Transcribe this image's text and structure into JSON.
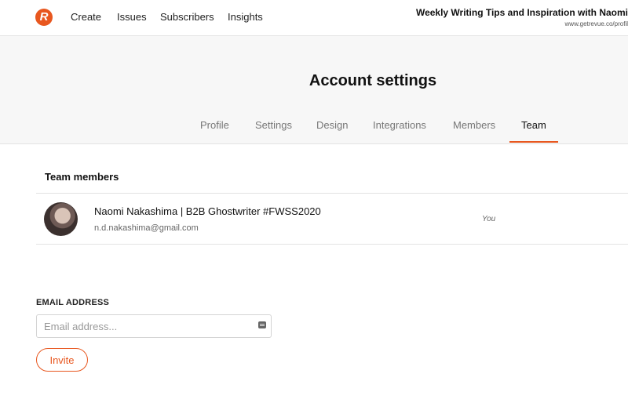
{
  "nav": {
    "logo_letter": "R",
    "links": [
      "Create",
      "Issues",
      "Subscribers",
      "Insights"
    ]
  },
  "publication": {
    "title": "Weekly Writing Tips and Inspiration with Naomi",
    "url": "www.getrevue.co/profil"
  },
  "page": {
    "title": "Account settings",
    "tabs": [
      "Profile",
      "Settings",
      "Design",
      "Integrations",
      "Members",
      "Team"
    ],
    "active_tab": "Team"
  },
  "team": {
    "section_title": "Team members",
    "members": [
      {
        "name": "Naomi Nakashima | B2B Ghostwriter #FWSS2020",
        "email": "n.d.nakashima@gmail.com",
        "role_note": "You"
      }
    ]
  },
  "invite": {
    "label": "EMAIL ADDRESS",
    "placeholder": "Email address...",
    "value": "",
    "button_label": "Invite"
  },
  "colors": {
    "accent": "#e8571f",
    "header_bg": "#f7f7f7",
    "divider": "#e3e3e3"
  },
  "icons": {
    "logo": "revue-logo-icon",
    "input_helper": "contact-card-icon"
  }
}
